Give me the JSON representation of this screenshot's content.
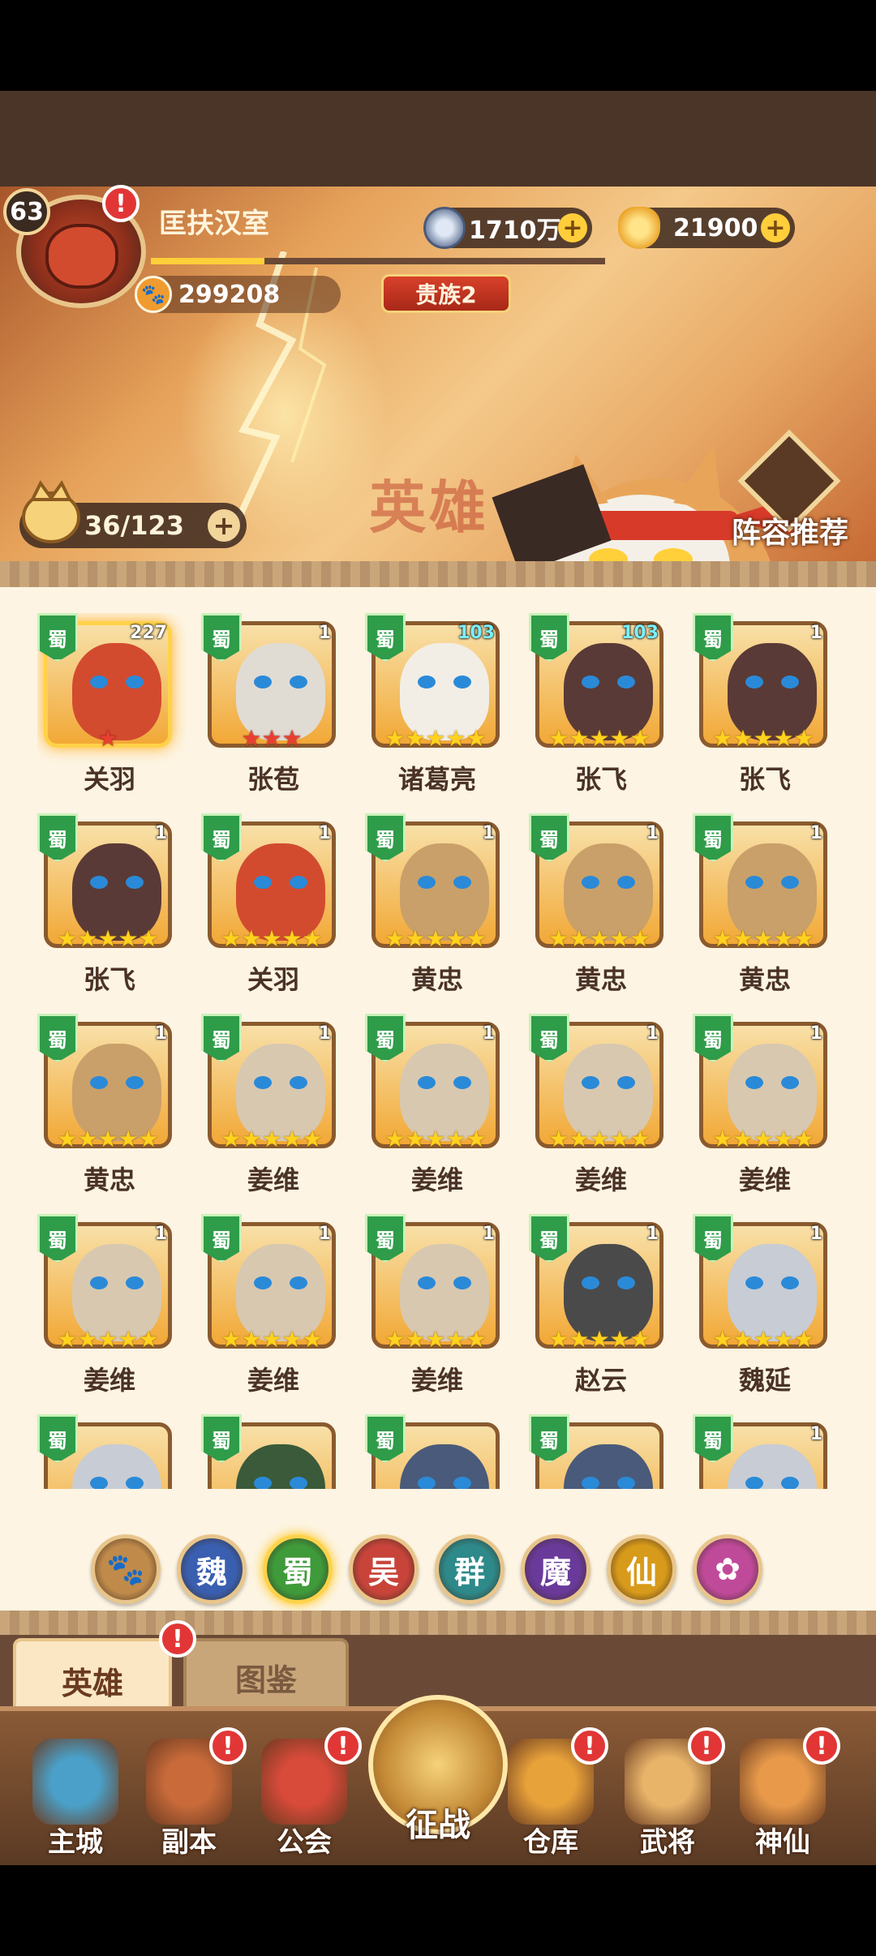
{
  "player": {
    "level": "63",
    "name": "匡扶汉室",
    "power": "299208",
    "exp_fraction": 0.25,
    "noble": "贵族2"
  },
  "resources": {
    "coins": "1710万",
    "ingots": "21900"
  },
  "banner": {
    "watermark": "英雄",
    "collection": "36/123",
    "lineup_label": "阵容推荐"
  },
  "heroes": [
    {
      "name": "关羽",
      "level": "227",
      "stars": 1,
      "star_color": "red",
      "faction": "蜀",
      "selected": true
    },
    {
      "name": "张苞",
      "level": "1",
      "stars": 3,
      "star_color": "red",
      "faction": "蜀"
    },
    {
      "name": "诸葛亮",
      "level": "103",
      "stars": 5,
      "star_color": "gold",
      "faction": "蜀",
      "level_blue": true
    },
    {
      "name": "张飞",
      "level": "103",
      "stars": 5,
      "star_color": "gold",
      "faction": "蜀",
      "level_blue": true
    },
    {
      "name": "张飞",
      "level": "1",
      "stars": 5,
      "star_color": "gold",
      "faction": "蜀"
    },
    {
      "name": "张飞",
      "level": "1",
      "stars": 5,
      "star_color": "gold",
      "faction": "蜀"
    },
    {
      "name": "关羽",
      "level": "1",
      "stars": 5,
      "star_color": "gold",
      "faction": "蜀"
    },
    {
      "name": "黄忠",
      "level": "1",
      "stars": 5,
      "star_color": "gold",
      "faction": "蜀"
    },
    {
      "name": "黄忠",
      "level": "1",
      "stars": 5,
      "star_color": "gold",
      "faction": "蜀"
    },
    {
      "name": "黄忠",
      "level": "1",
      "stars": 5,
      "star_color": "gold",
      "faction": "蜀"
    },
    {
      "name": "黄忠",
      "level": "1",
      "stars": 5,
      "star_color": "gold",
      "faction": "蜀"
    },
    {
      "name": "姜维",
      "level": "1",
      "stars": 5,
      "star_color": "gold",
      "faction": "蜀"
    },
    {
      "name": "姜维",
      "level": "1",
      "stars": 5,
      "star_color": "gold",
      "faction": "蜀"
    },
    {
      "name": "姜维",
      "level": "1",
      "stars": 5,
      "star_color": "gold",
      "faction": "蜀"
    },
    {
      "name": "姜维",
      "level": "1",
      "stars": 5,
      "star_color": "gold",
      "faction": "蜀"
    },
    {
      "name": "姜维",
      "level": "1",
      "stars": 5,
      "star_color": "gold",
      "faction": "蜀"
    },
    {
      "name": "姜维",
      "level": "1",
      "stars": 5,
      "star_color": "gold",
      "faction": "蜀"
    },
    {
      "name": "姜维",
      "level": "1",
      "stars": 5,
      "star_color": "gold",
      "faction": "蜀"
    },
    {
      "name": "赵云",
      "level": "1",
      "stars": 5,
      "star_color": "gold",
      "faction": "蜀"
    },
    {
      "name": "魏延",
      "level": "1",
      "stars": 5,
      "star_color": "gold",
      "faction": "蜀"
    },
    {
      "name": "",
      "level": "",
      "stars": 0,
      "star_color": "gold",
      "faction": "蜀"
    },
    {
      "name": "",
      "level": "",
      "stars": 0,
      "star_color": "gold",
      "faction": "蜀"
    },
    {
      "name": "",
      "level": "",
      "stars": 0,
      "star_color": "gold",
      "faction": "蜀"
    },
    {
      "name": "",
      "level": "",
      "stars": 0,
      "star_color": "gold",
      "faction": "蜀"
    },
    {
      "name": "",
      "level": "",
      "stars": 0,
      "star_color": "gold",
      "faction": "蜀",
      "level_visible": "1"
    }
  ],
  "factions": [
    {
      "label": "🐾",
      "icon": "paw-icon",
      "color": "#c08a4a"
    },
    {
      "label": "魏",
      "color": "#3a5fb0"
    },
    {
      "label": "蜀",
      "color": "#3f9a3a",
      "active": true
    },
    {
      "label": "吴",
      "color": "#c8443a"
    },
    {
      "label": "群",
      "color": "#2e8a8a"
    },
    {
      "label": "魔",
      "color": "#6a3a9a"
    },
    {
      "label": "仙",
      "color": "#d89a1a"
    },
    {
      "label": "✿",
      "icon": "fairy-icon",
      "color": "#c04a9a"
    }
  ],
  "tabs": {
    "heroes": "英雄",
    "codex": "图鉴"
  },
  "nav": [
    {
      "label": "主城",
      "icon": "castle-icon",
      "color": "#4aa0c8",
      "alert": false
    },
    {
      "label": "副本",
      "icon": "sword-icon",
      "color": "#c86a3a",
      "alert": true
    },
    {
      "label": "公会",
      "icon": "flag-icon",
      "color": "#d84a3a",
      "alert": true
    },
    {
      "label": "征战",
      "icon": "battle-icon",
      "color": "#e8b04a",
      "alert": false,
      "center": true
    },
    {
      "label": "仓库",
      "icon": "bag-icon",
      "color": "#e8a23a",
      "alert": true
    },
    {
      "label": "武将",
      "icon": "cat-general-icon",
      "color": "#e8b46a",
      "alert": true
    },
    {
      "label": "神仙",
      "icon": "cat-immortal-icon",
      "color": "#e89a4a",
      "alert": true
    }
  ],
  "alert_mark": "!"
}
